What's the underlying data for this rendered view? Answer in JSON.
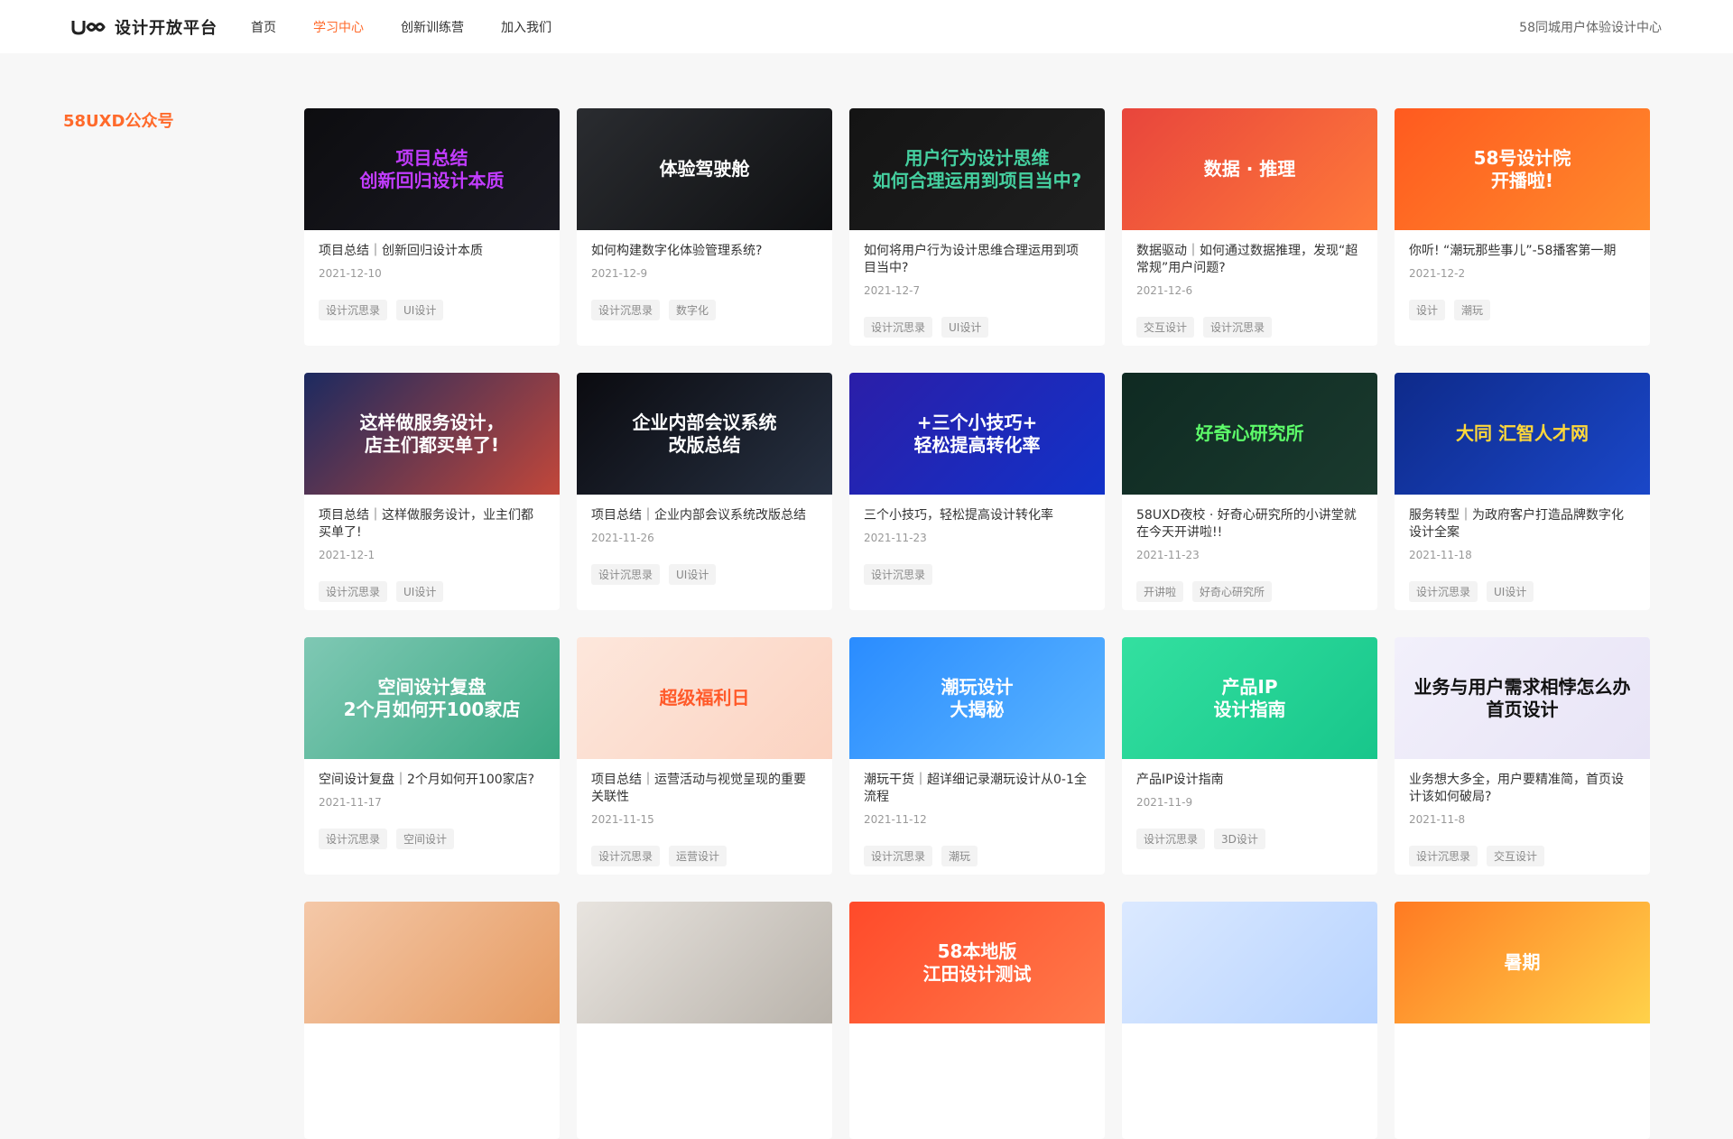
{
  "header": {
    "logo_mark": "U∞",
    "logo_text": "设计开放平台",
    "nav": [
      {
        "label": "首页",
        "active": false
      },
      {
        "label": "学习中心",
        "active": true
      },
      {
        "label": "创新训练营",
        "active": false
      },
      {
        "label": "加入我们",
        "active": false
      }
    ],
    "right_text": "58同城用户体验设计中心"
  },
  "sidebar": {
    "title": "58UXD公众号"
  },
  "cards": [
    {
      "title": "项目总结｜创新回归设计本质",
      "date": "2021-12-10",
      "tags": [
        "设计沉思录",
        "UI设计"
      ],
      "thumb_text": "项目总结\n创新回归设计本质",
      "bg": "linear-gradient(135deg,#0d0d10,#1a1a22)",
      "accent": "#c23cff"
    },
    {
      "title": "如何构建数字化体验管理系统?",
      "date": "2021-12-9",
      "tags": [
        "设计沉思录",
        "数字化"
      ],
      "thumb_text": "体验驾驶舱",
      "bg": "linear-gradient(135deg,#2a2c30,#0f1012)",
      "accent": "#ffffff"
    },
    {
      "title": "如何将用户行为设计思维合理运用到项目当中?",
      "date": "2021-12-7",
      "tags": [
        "设计沉思录",
        "UI设计"
      ],
      "thumb_text": "用户行为设计思维\n如何合理运用到项目当中?",
      "bg": "linear-gradient(135deg,#141414,#1f1f1f)",
      "accent": "#45d0a0"
    },
    {
      "title": "数据驱动｜如何通过数据推理，发现“超常规”用户问题?",
      "date": "2021-12-6",
      "tags": [
        "交互设计",
        "设计沉思录"
      ],
      "thumb_text": "数据 · 推理",
      "bg": "linear-gradient(135deg,#e8453c,#ff7a3a)",
      "accent": "#ffffff"
    },
    {
      "title": "你听! “潮玩那些事儿”-58播客第一期",
      "date": "2021-12-2",
      "tags": [
        "设计",
        "潮玩"
      ],
      "thumb_text": "58号设计院\n开播啦!",
      "bg": "linear-gradient(135deg,#ff5a1f,#ff8b2c)",
      "accent": "#ffffff"
    },
    {
      "title": "项目总结｜这样做服务设计，业主们都买单了!",
      "date": "2021-12-1",
      "tags": [
        "设计沉思录",
        "UI设计"
      ],
      "thumb_text": "这样做服务设计，\n店主们都买单了!",
      "bg": "linear-gradient(135deg,#1c2a60,#c2473a)",
      "accent": "#ffffff"
    },
    {
      "title": "项目总结｜企业内部会议系统改版总结",
      "date": "2021-11-26",
      "tags": [
        "设计沉思录",
        "UI设计"
      ],
      "thumb_text": "企业内部会议系统\n改版总结",
      "bg": "linear-gradient(135deg,#0b0b10,#263041)",
      "accent": "#ffffff"
    },
    {
      "title": "三个小技巧，轻松提高设计转化率",
      "date": "2021-11-23",
      "tags": [
        "设计沉思录"
      ],
      "thumb_text": "+三个小技巧+\n轻松提高转化率",
      "bg": "linear-gradient(135deg,#2b1ea8,#1232c8)",
      "accent": "#ffffff"
    },
    {
      "title": "58UXD夜校 · 好奇心研究所的小讲堂就在今天开讲啦!!",
      "date": "2021-11-23",
      "tags": [
        "开讲啦",
        "好奇心研究所"
      ],
      "thumb_text": "好奇心研究所",
      "bg": "linear-gradient(135deg,#0f2a22,#1a3a2e)",
      "accent": "#5dfc6a"
    },
    {
      "title": "服务转型｜为政府客户打造品牌数字化设计全案",
      "date": "2021-11-18",
      "tags": [
        "设计沉思录",
        "UI设计"
      ],
      "thumb_text": "大同 汇智人才网",
      "bg": "linear-gradient(135deg,#0e2a8a,#1a47c8)",
      "accent": "#ffd83a"
    },
    {
      "title": "空间设计复盘｜2个月如何开100家店?",
      "date": "2021-11-17",
      "tags": [
        "设计沉思录",
        "空间设计"
      ],
      "thumb_text": "空间设计复盘\n2个月如何开100家店",
      "bg": "linear-gradient(135deg,#7fc8b4,#3aa882)",
      "accent": "#ffffff"
    },
    {
      "title": "项目总结｜运营活动与视觉呈现的重要关联性",
      "date": "2021-11-15",
      "tags": [
        "设计沉思录",
        "运营设计"
      ],
      "thumb_text": "超级福利日",
      "bg": "linear-gradient(135deg,#fde7dc,#fbd3c1)",
      "accent": "#ff5a2a"
    },
    {
      "title": "潮玩干货｜超详细记录潮玩设计从0-1全流程",
      "date": "2021-11-12",
      "tags": [
        "设计沉思录",
        "潮玩"
      ],
      "thumb_text": "潮玩设计\n大揭秘",
      "bg": "linear-gradient(135deg,#2a8cff,#5bb5ff)",
      "accent": "#ffffff"
    },
    {
      "title": "产品IP设计指南",
      "date": "2021-11-9",
      "tags": [
        "设计沉思录",
        "3D设计"
      ],
      "thumb_text": "产品IP\n设计指南",
      "bg": "linear-gradient(135deg,#33e0a0,#18c68b)",
      "accent": "#ffffff"
    },
    {
      "title": "业务想大多全，用户要精准简，首页设计该如何破局?",
      "date": "2021-11-8",
      "tags": [
        "设计沉思录",
        "交互设计"
      ],
      "thumb_text": "业务与用户需求相悖怎么办\n首页设计",
      "bg": "linear-gradient(135deg,#f2f0fb,#e8e4f6)",
      "accent": "#111111"
    },
    {
      "title": "",
      "date": "",
      "tags": [],
      "thumb_text": "",
      "bg": "linear-gradient(135deg,#f4c8a8,#e69b62)",
      "accent": "#ffffff"
    },
    {
      "title": "",
      "date": "",
      "tags": [],
      "thumb_text": "",
      "bg": "linear-gradient(135deg,#e8e4df,#b9b3ab)",
      "accent": "#ffffff"
    },
    {
      "title": "",
      "date": "",
      "tags": [],
      "thumb_text": "58本地版\n江田设计测试",
      "bg": "linear-gradient(135deg,#ff4a2a,#ff7a4a)",
      "accent": "#ffffff"
    },
    {
      "title": "",
      "date": "",
      "tags": [],
      "thumb_text": "",
      "bg": "linear-gradient(135deg,#dbe9ff,#b7d3ff)",
      "accent": "#2a6cff"
    },
    {
      "title": "",
      "date": "",
      "tags": [],
      "thumb_text": "暑期",
      "bg": "linear-gradient(135deg,#ff7a22,#ffd24a)",
      "accent": "#ffffff"
    }
  ]
}
